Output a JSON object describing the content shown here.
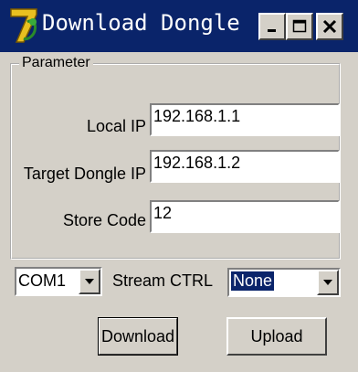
{
  "window": {
    "title": "Download Dongle",
    "icon": "delphi-app-icon",
    "controls": [
      "minimize-icon",
      "maximize-icon",
      "close-icon"
    ]
  },
  "parameter_group": {
    "legend": "Parameter",
    "fields": [
      {
        "label": "Local IP",
        "value": "192.168.1.1"
      },
      {
        "label": "Target Dongle IP",
        "value": "192.168.1.2"
      },
      {
        "label": "Store Code",
        "value": "12"
      }
    ]
  },
  "com_port": {
    "selected": "COM1"
  },
  "stream_ctrl": {
    "label": "Stream CTRL",
    "selected": "None"
  },
  "buttons": {
    "download": "Download",
    "upload": "Upload"
  },
  "colors": {
    "titlebar": "#0a246a",
    "face": "#d4d0c8",
    "selection": "#0a246a"
  }
}
